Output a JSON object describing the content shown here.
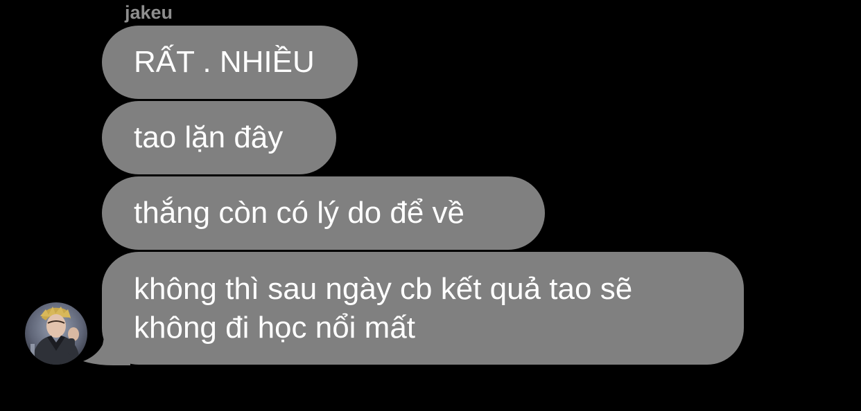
{
  "chat": {
    "sender_name": "jakeu",
    "messages": [
      {
        "text": "RẤT . NHIỀU"
      },
      {
        "text": "tao lặn đây"
      },
      {
        "text": "thắng còn có lý do để về"
      },
      {
        "text": "không thì sau ngày cb kết quả tao sẽ không đi học nổi mất"
      }
    ],
    "avatar_icon": "profile-photo-avatar"
  },
  "colors": {
    "background": "#000000",
    "bubble": "#808080",
    "text": "#ffffff",
    "sender_name": "#8e8e8e"
  }
}
